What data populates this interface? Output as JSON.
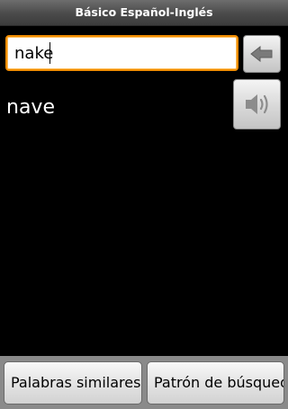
{
  "app": {
    "title": "Básico Español-Inglés"
  },
  "search": {
    "value": "nake"
  },
  "buttons": {
    "back_icon": "back-arrow-icon",
    "speaker_icon": "speaker-icon",
    "similar_words_label": "Palabras similares",
    "pattern_search_label": "Patrón de búsqueda"
  },
  "result": {
    "word": "nave"
  },
  "colors": {
    "background": "#000000",
    "input_focus_border": "#f08c00",
    "button_grey": "#d8d8d8",
    "icon_grey": "#7a7a7a"
  }
}
